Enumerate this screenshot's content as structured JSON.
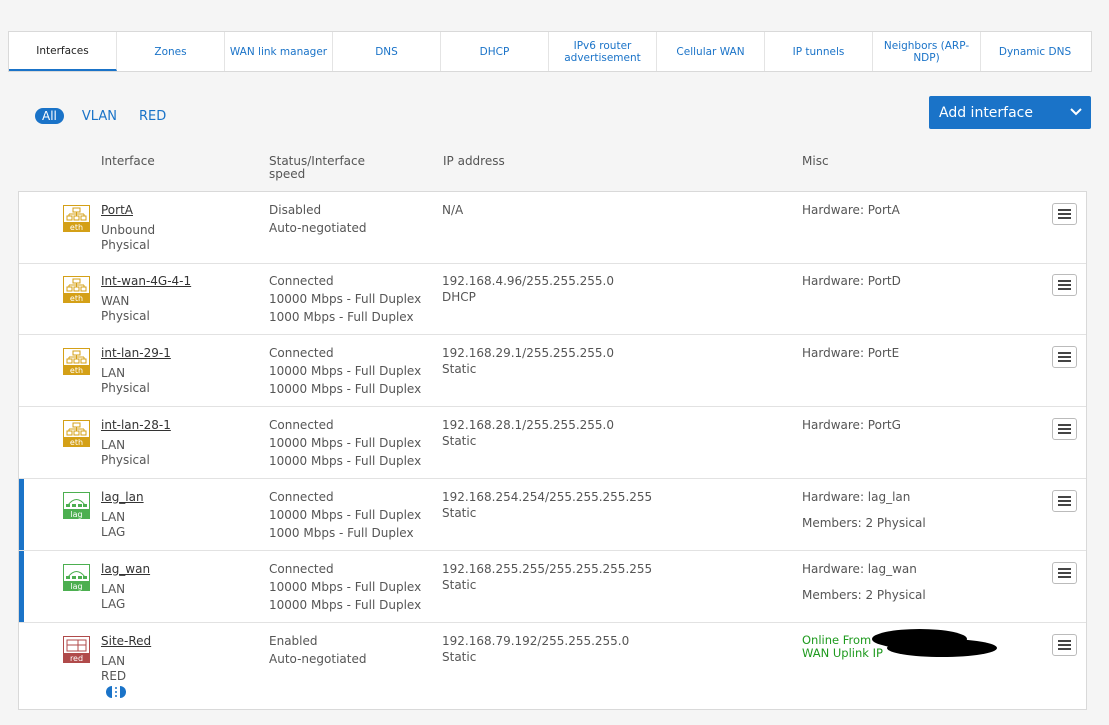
{
  "tabs": [
    {
      "label": "Interfaces"
    },
    {
      "label": "Zones"
    },
    {
      "label": "WAN link manager"
    },
    {
      "label": "DNS"
    },
    {
      "label": "DHCP"
    },
    {
      "label": "IPv6 router advertisement"
    },
    {
      "label": "Cellular WAN"
    },
    {
      "label": "IP tunnels"
    },
    {
      "label": "Neighbors (ARP-NDP)"
    },
    {
      "label": "Dynamic DNS"
    }
  ],
  "filters": {
    "all": "All",
    "vlan": "VLAN",
    "red": "RED"
  },
  "add_button": {
    "label": "Add interface"
  },
  "columns": {
    "interface": "Interface",
    "status_line1": "Status/Interface",
    "status_line2": "speed",
    "ip": "IP address",
    "misc": "Misc"
  },
  "rows": [
    {
      "icon_label": "eth",
      "name": "PortA",
      "zone": "Unbound",
      "type": "Physical",
      "status": "Disabled",
      "speed1": "Auto-negotiated",
      "speed2": "",
      "ip": "N/A",
      "ip_mode": "",
      "misc1": "Hardware:  PortA",
      "misc2": ""
    },
    {
      "icon_label": "eth",
      "name": "Int-wan-4G-4-1",
      "zone": "WAN",
      "type": "Physical",
      "status": "Connected",
      "speed1": "10000 Mbps - Full Duplex",
      "speed2": "1000 Mbps - Full Duplex",
      "ip": "192.168.4.96/255.255.255.0",
      "ip_mode": "DHCP",
      "misc1": "Hardware:  PortD",
      "misc2": ""
    },
    {
      "icon_label": "eth",
      "name": "int-lan-29-1",
      "zone": "LAN",
      "type": "Physical",
      "status": "Connected",
      "speed1": "10000 Mbps - Full Duplex",
      "speed2": "10000 Mbps - Full Duplex",
      "ip": "192.168.29.1/255.255.255.0",
      "ip_mode": "Static",
      "misc1": "Hardware:  PortE",
      "misc2": ""
    },
    {
      "icon_label": "eth",
      "name": "int-lan-28-1",
      "zone": "LAN",
      "type": "Physical",
      "status": "Connected",
      "speed1": "10000 Mbps - Full Duplex",
      "speed2": "10000 Mbps - Full Duplex",
      "ip": "192.168.28.1/255.255.255.0",
      "ip_mode": "Static",
      "misc1": "Hardware:  PortG",
      "misc2": ""
    },
    {
      "icon_label": "lag",
      "name": "lag_lan",
      "zone": "LAN",
      "type": "LAG",
      "status": "Connected",
      "speed1": "10000 Mbps - Full Duplex",
      "speed2": "1000 Mbps - Full Duplex",
      "ip": "192.168.254.254/255.255.255.255",
      "ip_mode": "Static",
      "misc1": "Hardware:  lag_lan",
      "misc2": "Members: 2 Physical"
    },
    {
      "icon_label": "lag",
      "name": "lag_wan",
      "zone": "LAN",
      "type": "LAG",
      "status": "Connected",
      "speed1": "10000 Mbps - Full Duplex",
      "speed2": "10000 Mbps - Full Duplex",
      "ip": "192.168.255.255/255.255.255.255",
      "ip_mode": "Static",
      "misc1": "Hardware:  lag_wan",
      "misc2": "Members: 2 Physical"
    },
    {
      "icon_label": "red",
      "name": "Site-Red",
      "zone": "LAN",
      "type": "RED",
      "status": "Enabled",
      "speed1": "Auto-negotiated",
      "speed2": "",
      "ip": "192.168.79.192/255.255.255.0",
      "ip_mode": "Static",
      "misc1": "Online From",
      "misc2": "WAN Uplink IP"
    }
  ],
  "colors": {
    "accent": "#1a73c8",
    "eth_icon": "#d4a017",
    "lag_icon": "#4caf50",
    "red_icon": "#b04a4a",
    "online": "#1e9a1e"
  }
}
